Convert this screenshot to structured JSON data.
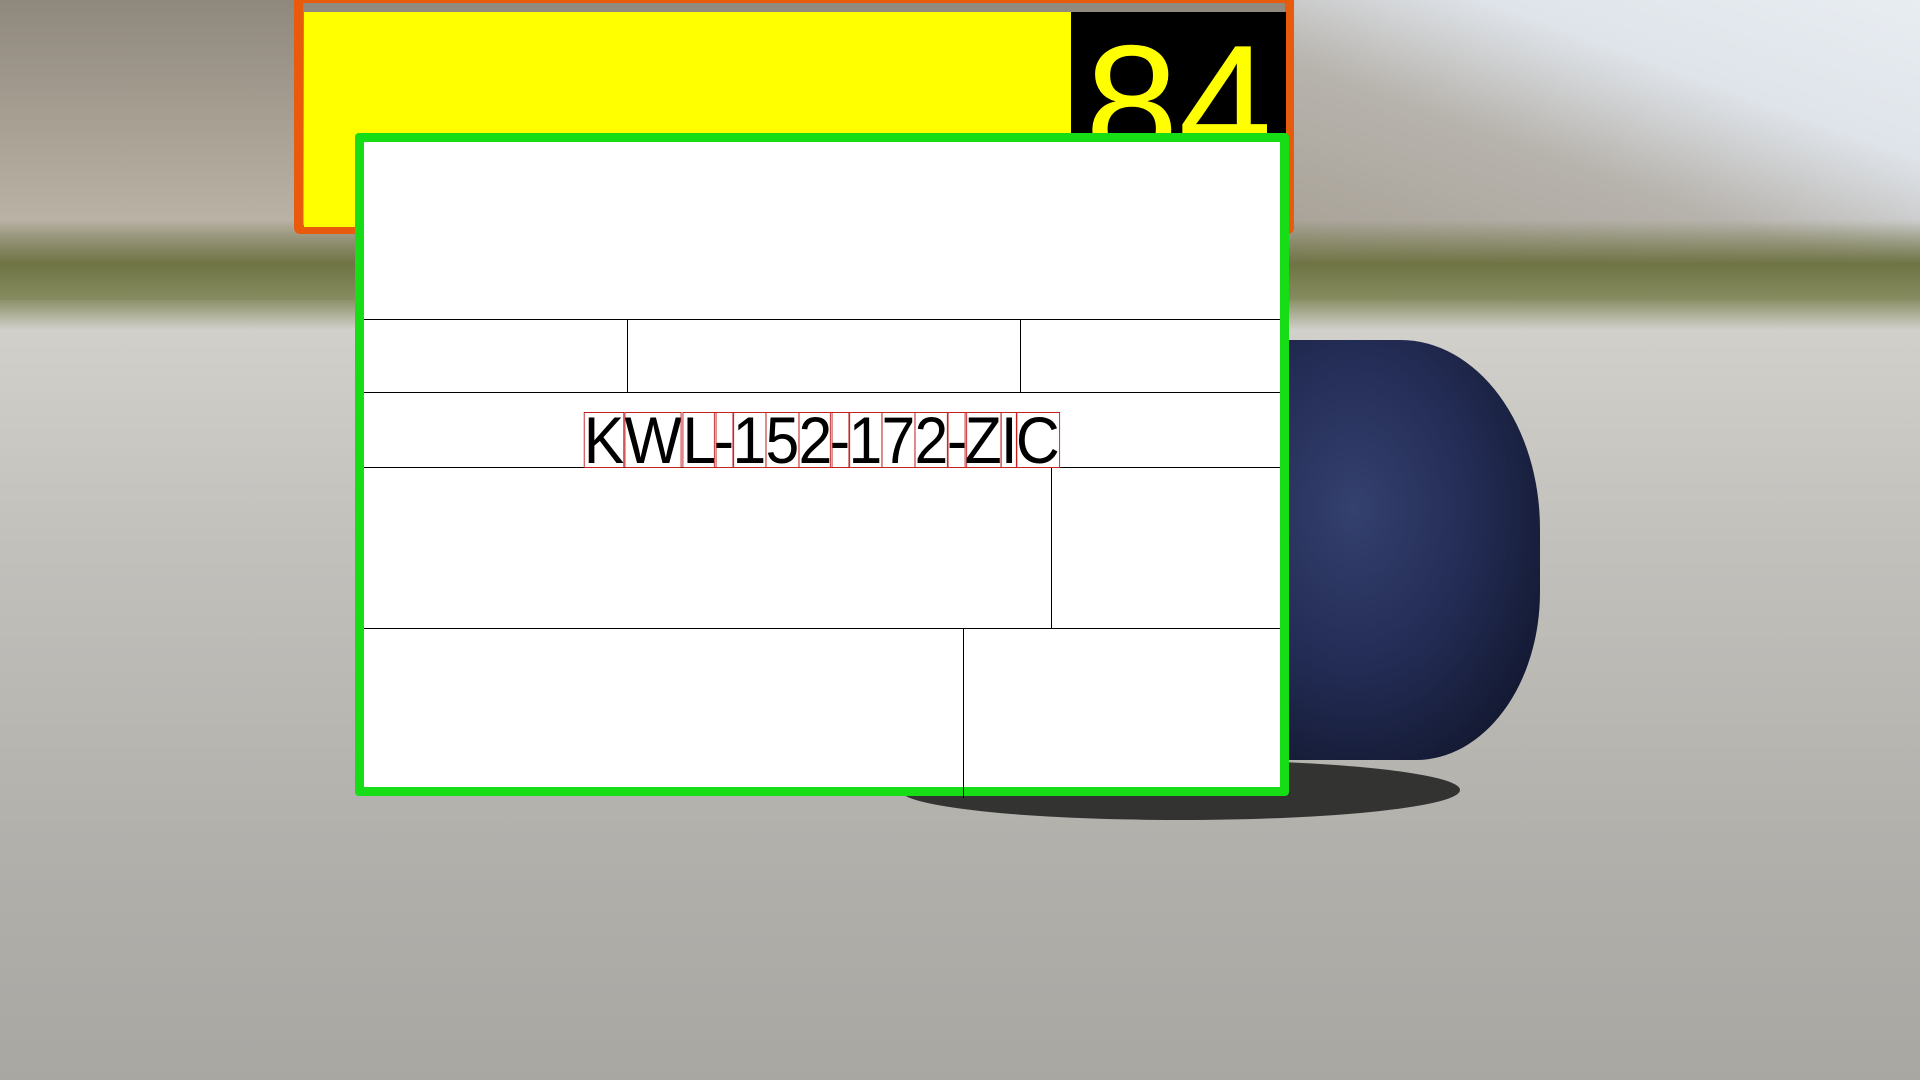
{
  "scene": {
    "description_colors": {
      "frame_orange": "#e85a0c",
      "frame_green": "#16dd16",
      "banner_yellow": "#ffff00",
      "char_box_red": "#c42020"
    }
  },
  "banner": {
    "number": "84"
  },
  "form": {
    "plate_text": "KWL-152-172-ZIC"
  }
}
